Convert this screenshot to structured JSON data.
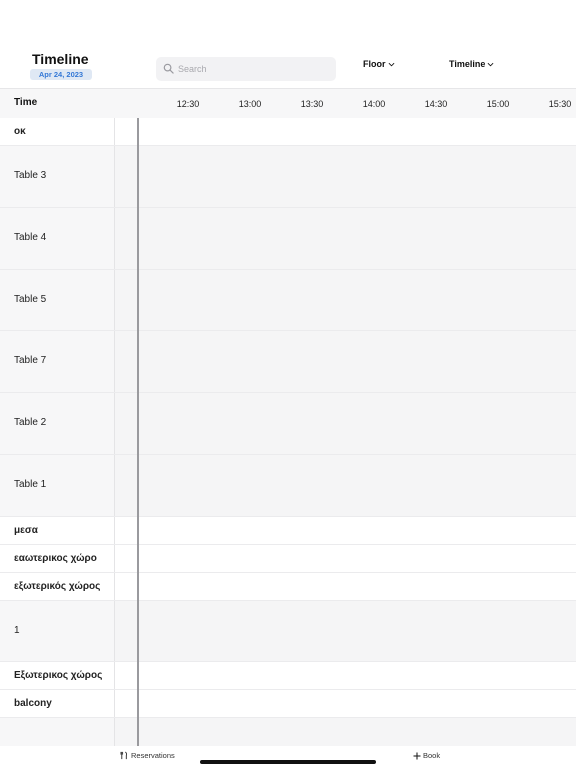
{
  "header": {
    "title": "Timeline",
    "date": "Apr 24, 2023",
    "search_placeholder": "Search",
    "floor_label": "Floor",
    "view_label": "Timeline"
  },
  "timeline": {
    "time_label": "Time",
    "ticks": [
      "12:30",
      "13:00",
      "13:30",
      "14:00",
      "14:30",
      "15:00",
      "15:30"
    ]
  },
  "rows": [
    {
      "label": "οκ",
      "kind": "section"
    },
    {
      "label": "Table 3",
      "kind": "table"
    },
    {
      "label": "Table 4",
      "kind": "table"
    },
    {
      "label": "Table 5",
      "kind": "table"
    },
    {
      "label": "Table 7",
      "kind": "table"
    },
    {
      "label": "Table 2",
      "kind": "table"
    },
    {
      "label": "Table 1",
      "kind": "table"
    },
    {
      "label": "μεσα",
      "kind": "section"
    },
    {
      "label": "εαωτερικος χώρο",
      "kind": "section"
    },
    {
      "label": "εξωτερικός χώρος",
      "kind": "section"
    },
    {
      "label": "1",
      "kind": "table"
    },
    {
      "label": "Εξωτερικος χώρος",
      "kind": "section"
    },
    {
      "label": "balcony",
      "kind": "section"
    },
    {
      "label": "",
      "kind": "table"
    }
  ],
  "bottom_bar": {
    "reservations_label": "Reservations",
    "book_label": "Book"
  },
  "icons": {
    "search": "search-icon",
    "chevron": "chevron-down-icon",
    "reservations": "fork-knife-icon",
    "book": "plus-icon"
  },
  "colors": {
    "accent": "#3478d6",
    "badge_bg": "#dfe8f4",
    "now_line": "#9a9a9e"
  }
}
